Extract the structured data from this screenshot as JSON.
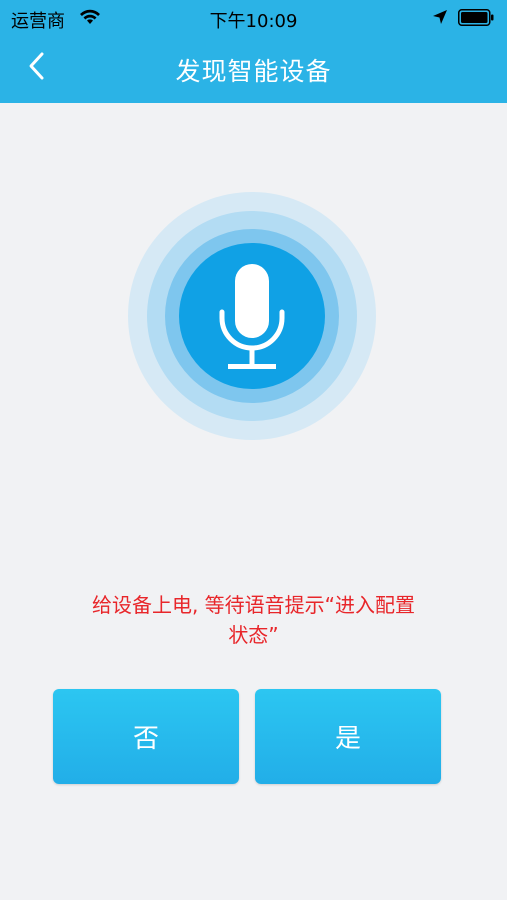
{
  "status_bar": {
    "carrier": "运营商",
    "time": "下午10:09"
  },
  "nav": {
    "title": "发现智能设备"
  },
  "hint": {
    "line1": "给设备上电, 等待语音提示“进入配置",
    "line2": "状态”"
  },
  "buttons": {
    "no_label": "否",
    "yes_label": "是"
  },
  "icons": {
    "back": "chevron-left-icon",
    "mic": "microphone-icon",
    "wifi": "wifi-icon",
    "location": "location-arrow-icon",
    "battery": "battery-icon"
  },
  "colors": {
    "header": "#2bb3e6",
    "accent": "#10a1e5",
    "hint": "#e8262a",
    "background": "#f1f2f4"
  }
}
